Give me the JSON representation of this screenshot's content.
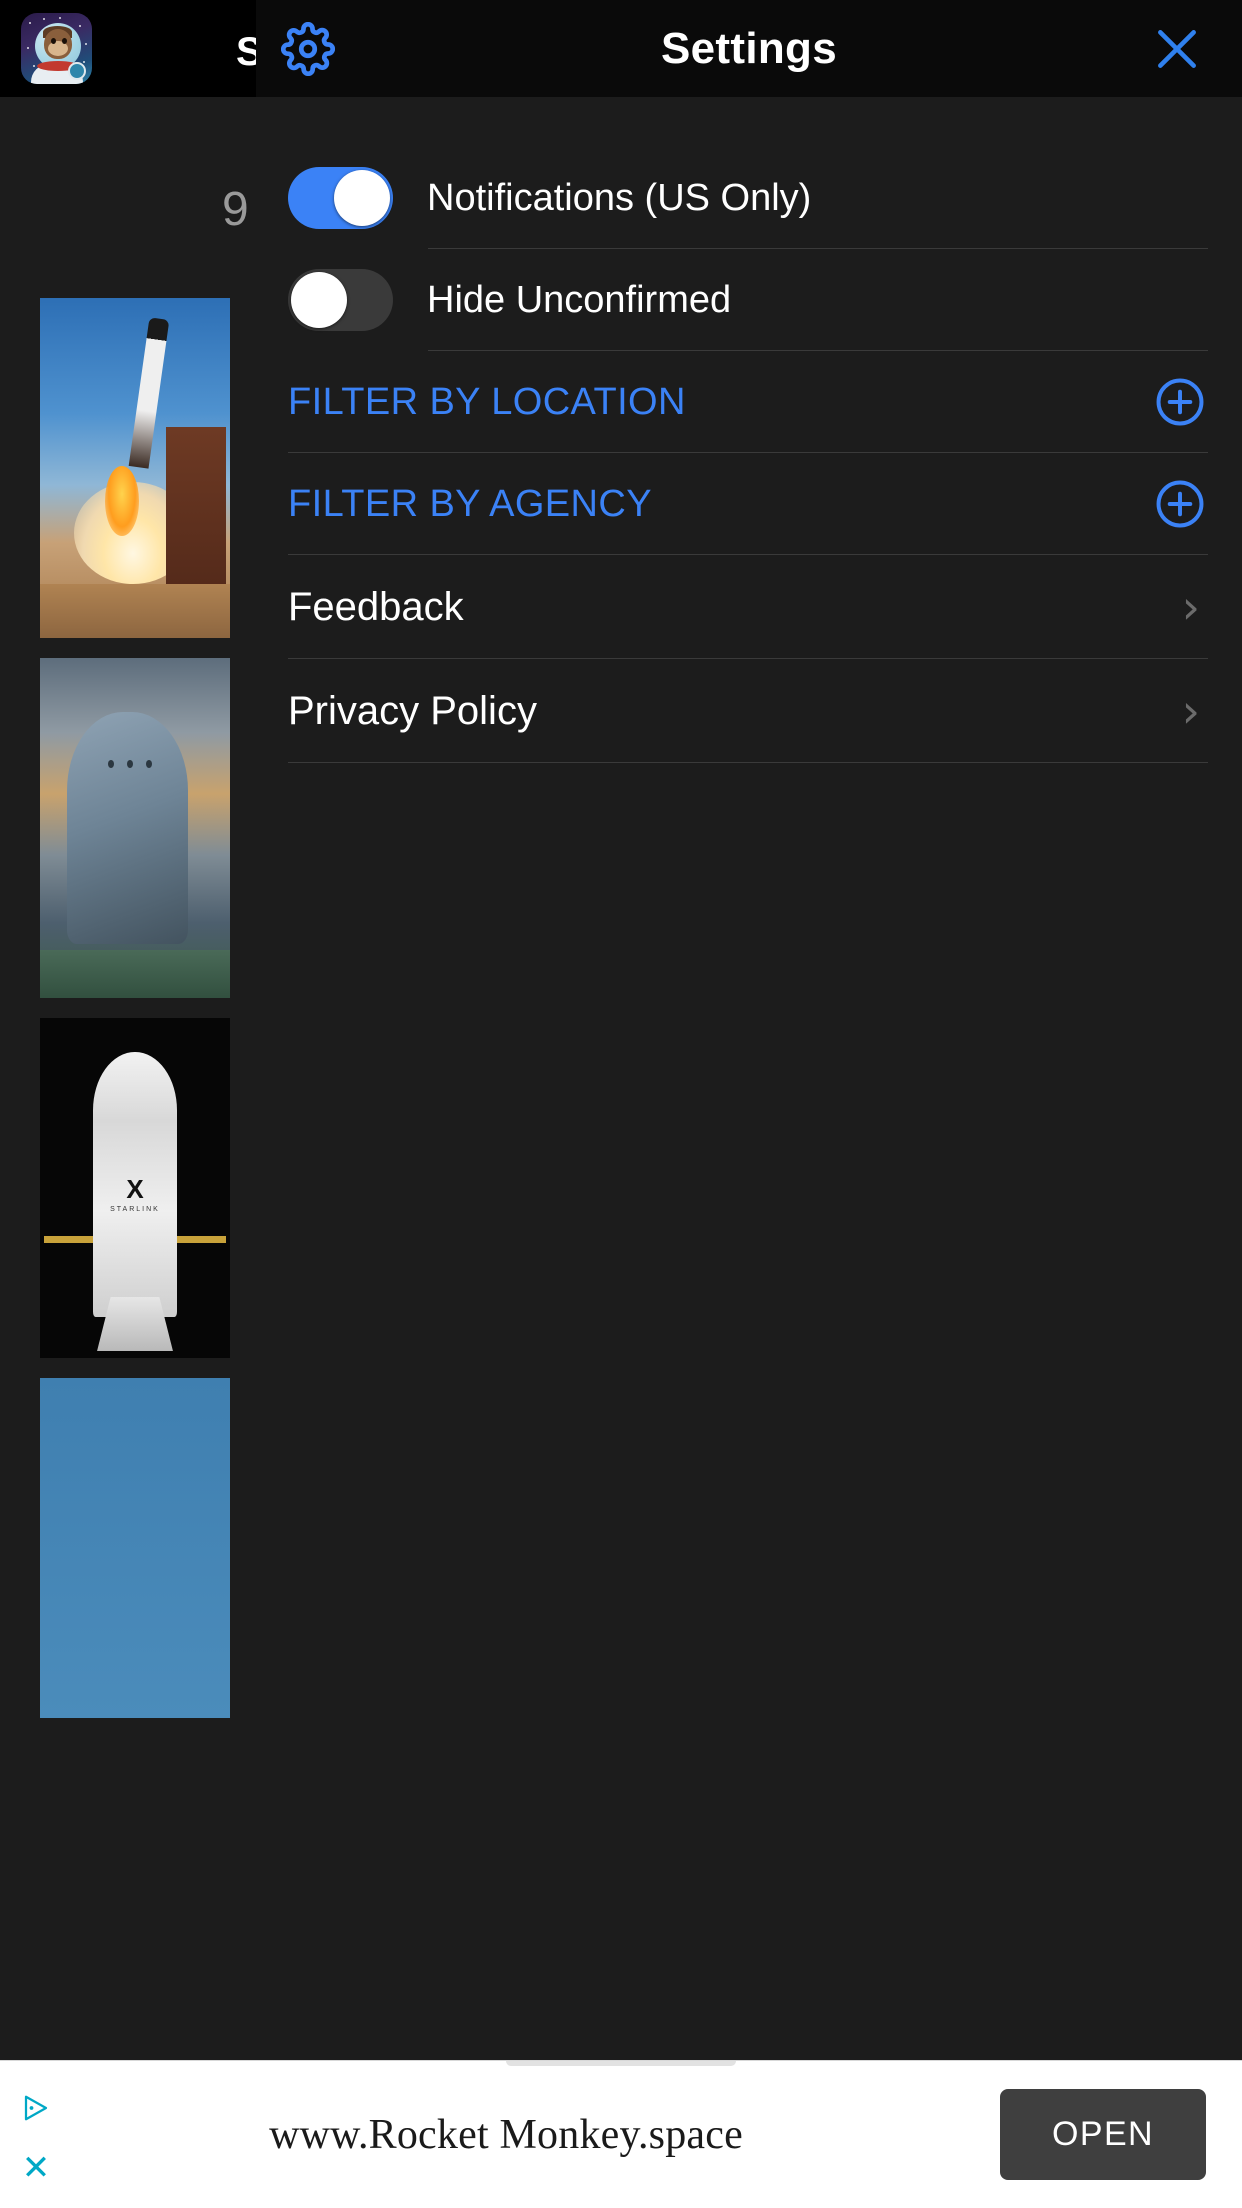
{
  "background": {
    "app_icon_name": "monkey-astronaut-app-icon",
    "partial_title": "S",
    "launch_count": "9",
    "cards": [
      {
        "name": "falcon-launch-photo"
      },
      {
        "name": "dragon-capsule-photo"
      },
      {
        "name": "starlink-fairing-photo"
      },
      {
        "name": "blue-partial-photo"
      }
    ]
  },
  "panel": {
    "title": "Settings",
    "gear_icon": "gear-icon",
    "close_icon": "close-icon",
    "accent_color": "#3b82f6",
    "toggles": [
      {
        "label": "Notifications (US Only)",
        "state": "on"
      },
      {
        "label": "Hide Unconfirmed",
        "state": "off"
      }
    ],
    "filters": [
      {
        "label": "FILTER BY LOCATION",
        "action_icon": "plus-circle-icon"
      },
      {
        "label": "FILTER BY AGENCY",
        "action_icon": "plus-circle-icon"
      }
    ],
    "links": [
      {
        "label": "Feedback",
        "chevron": "›"
      },
      {
        "label": "Privacy Policy",
        "chevron": "›"
      }
    ]
  },
  "ad": {
    "url_text": "www.Rocket Monkey.space",
    "open_label": "OPEN",
    "adchoices_icon": "adchoices-icon",
    "close_icon": "ad-close-icon",
    "close_glyph": "✕"
  }
}
